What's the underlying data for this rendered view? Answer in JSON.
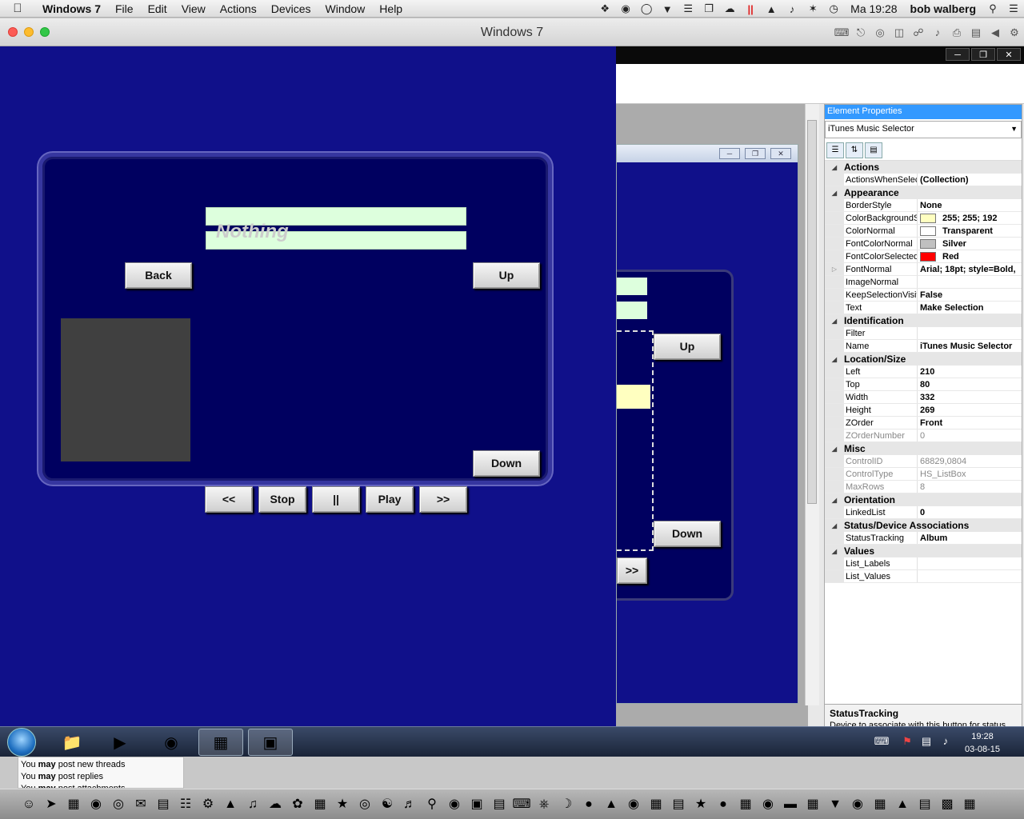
{
  "menubar": {
    "app": "Windows 7",
    "items": [
      "File",
      "Edit",
      "View",
      "Actions",
      "Devices",
      "Window",
      "Help"
    ],
    "clock": "Ma 19:28",
    "user": "bob walberg"
  },
  "window": {
    "title": "Windows 7"
  },
  "player": {
    "now_playing": "Nothing",
    "back": "Back",
    "up": "Up",
    "down": "Down",
    "transport": [
      "<<",
      "Stop",
      "||",
      "Play",
      ">>"
    ]
  },
  "designer": {
    "up": "Up",
    "down": "Down",
    "next": ">>"
  },
  "properties": {
    "header": "Element Properties",
    "selected": "iTunes Music Selector",
    "categories": [
      {
        "name": "Actions",
        "rows": [
          {
            "n": "ActionsWhenSelec",
            "v": "(Collection)"
          }
        ]
      },
      {
        "name": "Appearance",
        "rows": [
          {
            "n": "BorderStyle",
            "v": "None"
          },
          {
            "n": "ColorBackgroundS",
            "v": "255; 255; 192",
            "color": "#ffffc0"
          },
          {
            "n": "ColorNormal",
            "v": "Transparent",
            "color": "#ffffff"
          },
          {
            "n": "FontColorNormal",
            "v": "Silver",
            "color": "#c0c0c0"
          },
          {
            "n": "FontColorSelected",
            "v": "Red",
            "color": "#ff0000"
          },
          {
            "n": "FontNormal",
            "v": "Arial; 18pt; style=Bold,",
            "expand": true
          },
          {
            "n": "ImageNormal",
            "v": ""
          },
          {
            "n": "KeepSelectionVisit",
            "v": "False"
          },
          {
            "n": "Text",
            "v": "Make Selection"
          }
        ]
      },
      {
        "name": "Identification",
        "rows": [
          {
            "n": "Filter",
            "v": ""
          },
          {
            "n": "Name",
            "v": "iTunes Music Selector"
          }
        ]
      },
      {
        "name": "Location/Size",
        "rows": [
          {
            "n": "Left",
            "v": "210"
          },
          {
            "n": "Top",
            "v": "80"
          },
          {
            "n": "Width",
            "v": "332"
          },
          {
            "n": "Height",
            "v": "269"
          },
          {
            "n": "ZOrder",
            "v": "Front"
          },
          {
            "n": "ZOrderNumber",
            "v": "0",
            "ro": true
          }
        ]
      },
      {
        "name": "Misc",
        "rows": [
          {
            "n": "ControlID",
            "v": "68829,0804",
            "ro": true
          },
          {
            "n": "ControlType",
            "v": "HS_ListBox",
            "ro": true
          },
          {
            "n": "MaxRows",
            "v": "8",
            "ro": true
          }
        ]
      },
      {
        "name": "Orientation",
        "rows": [
          {
            "n": "LinkedList",
            "v": "0"
          }
        ]
      },
      {
        "name": "Status/Device Associations",
        "rows": [
          {
            "n": "StatusTracking",
            "v": "Album"
          }
        ]
      },
      {
        "name": "Values",
        "rows": [
          {
            "n": "List_Labels",
            "v": ""
          },
          {
            "n": "List_Values",
            "v": ""
          }
        ]
      }
    ],
    "desc_title": "StatusTracking",
    "desc_text": "Device to associate with this button for status."
  },
  "taskbar": {
    "time": "19:28",
    "date": "03-08-15"
  },
  "forum": {
    "lines": [
      {
        "pre": "You ",
        "bold": "may",
        "post": " post new threads"
      },
      {
        "pre": "You ",
        "bold": "may",
        "post": " post replies"
      },
      {
        "pre": "You ",
        "bold": "may",
        "post": " post attachments"
      }
    ]
  },
  "icons": {
    "apple": "apple-icon",
    "colors": {
      "vm_blue": "#10108a",
      "panel_blue": "#000060",
      "lcd_green": "#ddffdd",
      "selected_blue": "#3399ff"
    }
  }
}
